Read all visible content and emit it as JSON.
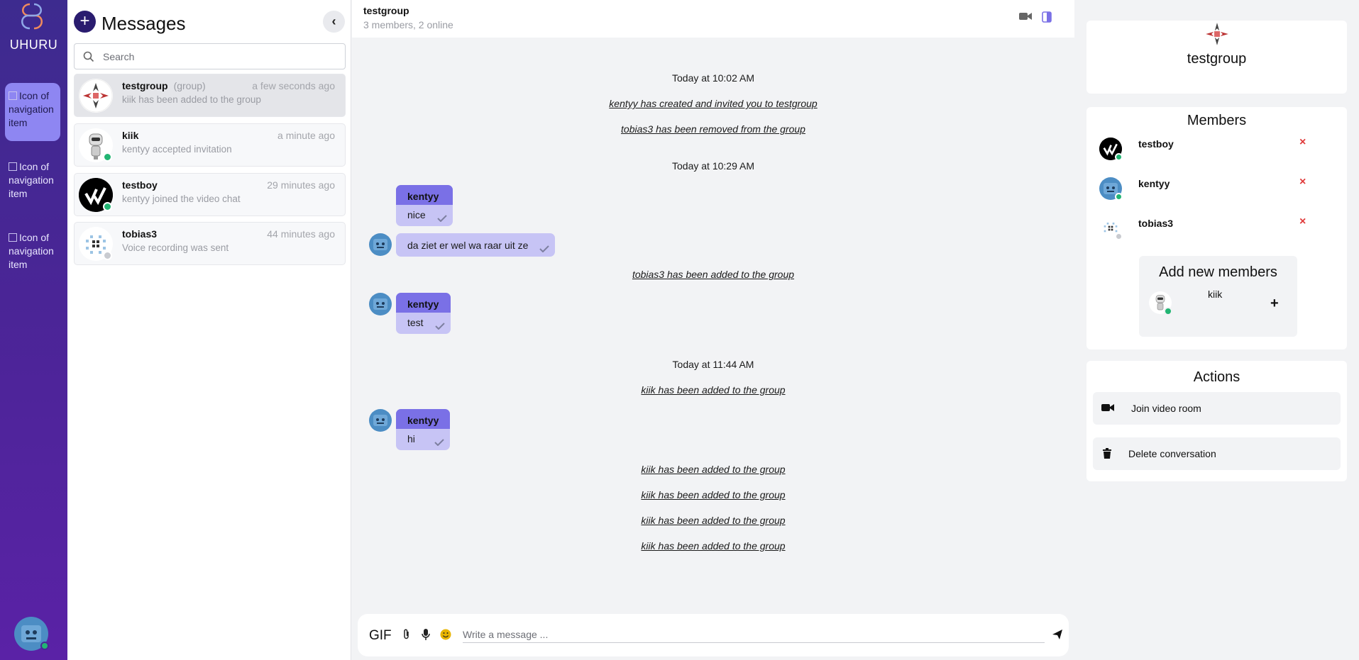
{
  "app": {
    "brand": "UHURU"
  },
  "nav": {
    "items": [
      {
        "alt": "Icon of navigation item"
      },
      {
        "alt": "Icon of navigation item"
      },
      {
        "alt": "Icon of navigation item"
      }
    ]
  },
  "list": {
    "title": "Messages",
    "new_button": "+",
    "collapse_button": "‹",
    "search_placeholder": "Search",
    "conversations": [
      {
        "name": "testgroup",
        "tag": "(group)",
        "time": "a few seconds ago",
        "last": "kiik has been added to the group",
        "status": "none"
      },
      {
        "name": "kiik",
        "tag": "",
        "time": "a minute ago",
        "last": "kentyy accepted invitation",
        "status": "online"
      },
      {
        "name": "testboy",
        "tag": "",
        "time": "29 minutes ago",
        "last": "kentyy joined the video chat",
        "status": "online"
      },
      {
        "name": "tobias3",
        "tag": "",
        "time": "44 minutes ago",
        "last": "Voice recording was sent",
        "status": "offline"
      }
    ]
  },
  "chat": {
    "title": "testgroup",
    "subtitle": "3 members, 2 online",
    "timeline": [
      {
        "kind": "timestamp",
        "text": "Today at 10:02 AM"
      },
      {
        "kind": "system",
        "text": "kentyy has created and invited you to testgroup"
      },
      {
        "kind": "system",
        "text": "tobias3 has been removed from the group"
      },
      {
        "kind": "timestamp",
        "text": "Today at 10:29 AM"
      },
      {
        "kind": "message",
        "author": "kentyy",
        "text": "nice"
      },
      {
        "kind": "message",
        "author": "",
        "text": "da ziet er wel wa raar uit ze"
      },
      {
        "kind": "system",
        "text": "tobias3 has been added to the group"
      },
      {
        "kind": "message",
        "author": "kentyy",
        "text": "test"
      },
      {
        "kind": "timestamp",
        "text": "Today at 11:44 AM"
      },
      {
        "kind": "system",
        "text": "kiik has been added to the group"
      },
      {
        "kind": "message",
        "author": "kentyy",
        "text": "hi"
      },
      {
        "kind": "system",
        "text": "kiik has been added to the group"
      },
      {
        "kind": "system",
        "text": "kiik has been added to the group"
      },
      {
        "kind": "system",
        "text": "kiik has been added to the group"
      },
      {
        "kind": "system",
        "text": "kiik has been added to the group"
      }
    ],
    "composer": {
      "gif_label": "GIF",
      "placeholder": "Write a message ..."
    }
  },
  "details": {
    "group_name": "testgroup",
    "members_title": "Members",
    "members": [
      {
        "name": "testboy",
        "status": "online",
        "remove": "×"
      },
      {
        "name": "kentyy",
        "status": "online",
        "remove": "×"
      },
      {
        "name": "tobias3",
        "status": "offline",
        "remove": "×"
      }
    ],
    "add_title": "Add new members",
    "candidates": [
      {
        "name": "kiik",
        "status": "online",
        "add": "+"
      }
    ],
    "actions_title": "Actions",
    "actions": [
      {
        "label": "Join video room",
        "icon": "video-camera-icon"
      },
      {
        "label": "Delete conversation",
        "icon": "trash-icon"
      }
    ]
  },
  "colors": {
    "online": "#22b573",
    "offline": "#c9cbd0",
    "accent": "#7a70e6",
    "bubble": "#c7c4f5",
    "remove": "#e03a3a"
  }
}
